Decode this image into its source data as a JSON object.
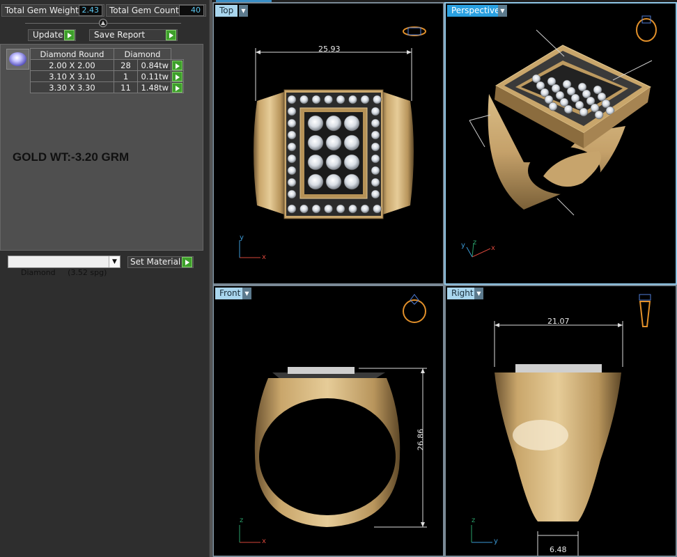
{
  "stats": {
    "total_weight_label": "Total Gem Weight",
    "total_weight_value": "2.43",
    "total_count_label": "Total Gem Count",
    "total_count_value": "40"
  },
  "actions": {
    "update_label": "Update",
    "save_report_label": "Save Report"
  },
  "gem_table": {
    "headers": [
      "Diamond Round",
      "Diamond"
    ],
    "rows": [
      {
        "size": "2.00 X 2.00",
        "count": "28",
        "weight": "0.84tw"
      },
      {
        "size": "3.10 X 3.10",
        "count": "1",
        "weight": "0.11tw"
      },
      {
        "size": "3.30 X 3.30",
        "count": "11",
        "weight": "1.48tw"
      }
    ]
  },
  "gold_weight": "GOLD WT:-3.20 GRM",
  "material": {
    "selected": "Diamond     (3.52 spg)",
    "set_label": "Set Material"
  },
  "viewports": {
    "top": {
      "label": "Top",
      "dimension": "25.93"
    },
    "perspective": {
      "label": "Perspective"
    },
    "front": {
      "label": "Front",
      "dimension": "26.86"
    },
    "right": {
      "label": "Right",
      "dimension_top": "21.07",
      "dimension_bottom": "6.48"
    }
  },
  "axes": {
    "x": "x",
    "y": "y",
    "z": "z"
  },
  "colors": {
    "gold": "#c9a66b",
    "viewport_label": "#a9d6ee",
    "active_label": "#2aa0e0",
    "accent_green": "#3ea02b",
    "value_blue": "#5cc6ee"
  },
  "icons": [
    "collapse-knob-icon",
    "play-arrow-icon",
    "dropdown-arrow-icon",
    "diamond-gem-icon",
    "ring-thumbnail-icon"
  ]
}
